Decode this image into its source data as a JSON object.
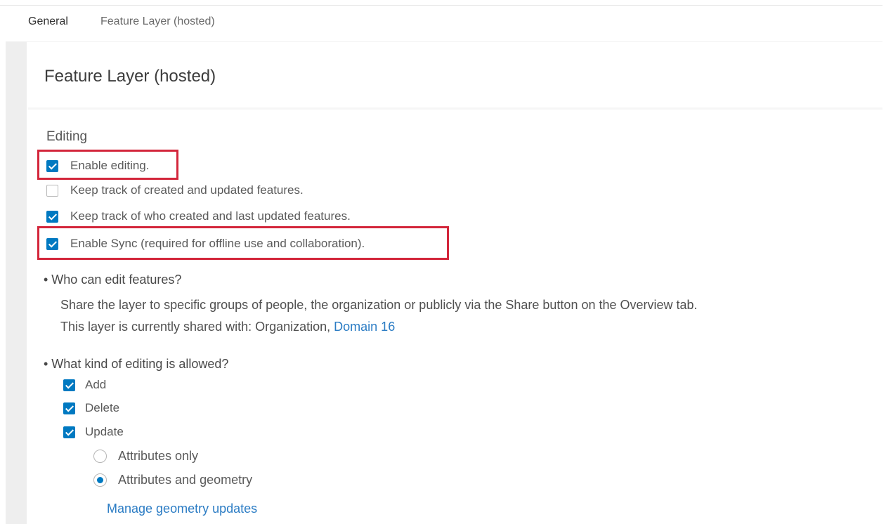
{
  "tabs": {
    "general": "General",
    "feature_layer": "Feature Layer (hosted)"
  },
  "panel": {
    "title": "Feature Layer (hosted)"
  },
  "editing": {
    "section_title": "Editing",
    "options": [
      {
        "label": "Enable editing.",
        "checked": true,
        "highlighted": true
      },
      {
        "label": "Keep track of created and updated features.",
        "checked": false,
        "highlighted": false
      },
      {
        "label": "Keep track of who created and last updated features.",
        "checked": true,
        "highlighted": false
      },
      {
        "label": "Enable Sync (required for offline use and collaboration).",
        "checked": true,
        "highlighted": true
      }
    ]
  },
  "who_can_edit": {
    "heading": "• Who can edit features?",
    "description": "Share the layer to specific groups of people, the organization or publicly via the Share button on the Overview tab.",
    "shared_prefix": "This layer is currently shared with: Organization, ",
    "shared_link": "Domain 16"
  },
  "edit_kind": {
    "heading": "• What kind of editing is allowed?",
    "options": [
      {
        "label": "Add",
        "checked": true
      },
      {
        "label": "Delete",
        "checked": true
      },
      {
        "label": "Update",
        "checked": true
      }
    ],
    "update_modes": [
      {
        "label": "Attributes only",
        "selected": false
      },
      {
        "label": "Attributes and geometry",
        "selected": true
      }
    ],
    "manage_link": "Manage geometry updates"
  },
  "colors": {
    "accent": "#0079c1",
    "highlight_border": "#d3263b",
    "link": "#2b7cc4"
  }
}
